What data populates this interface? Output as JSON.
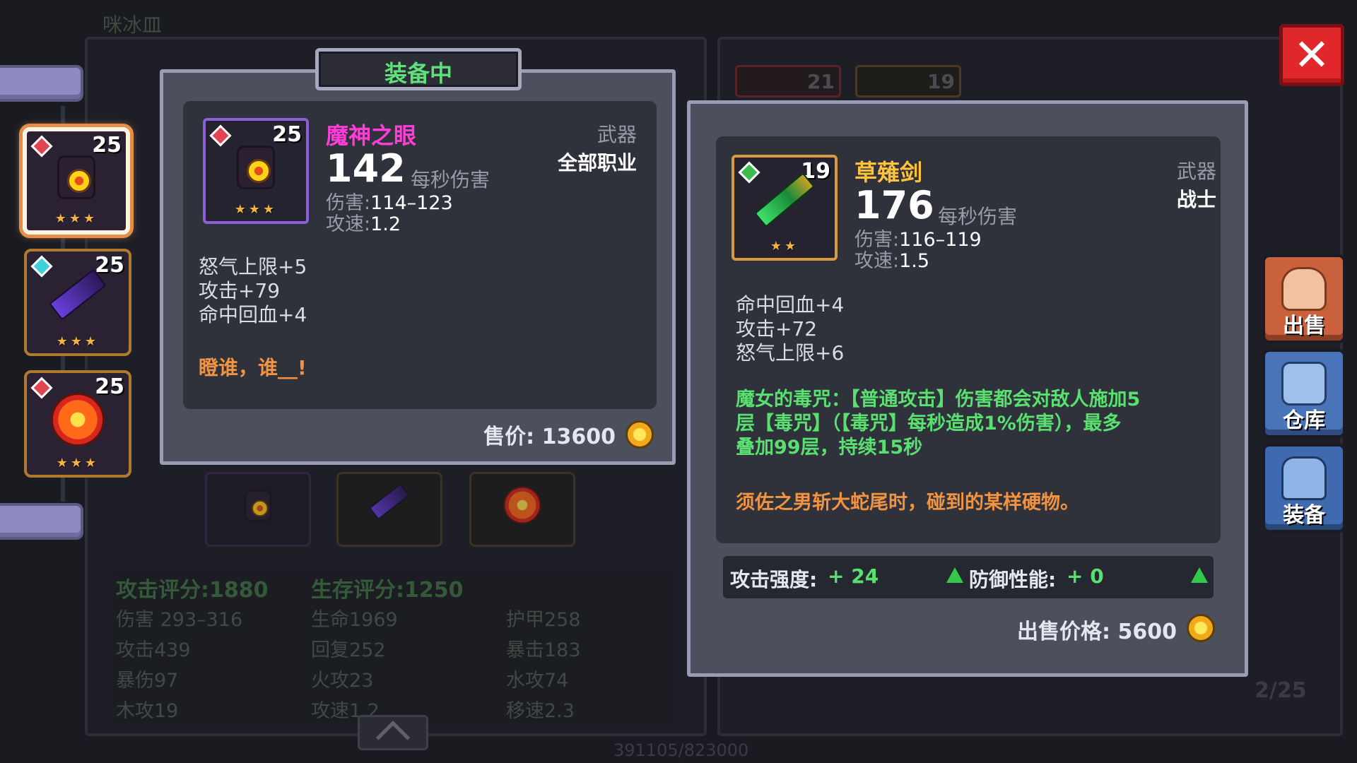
{
  "background": {
    "top_title": "咪冰皿",
    "page_indicator": "2/25",
    "exp_text": "391105/823000",
    "mini_counts": [
      "21",
      "19"
    ]
  },
  "left_slots": [
    {
      "level": "25",
      "gem": "red",
      "stars": "★★★",
      "item": "eye",
      "selected": true
    },
    {
      "level": "25",
      "gem": "cyan",
      "stars": "★★★",
      "item": "sword",
      "selected": false
    },
    {
      "level": "25",
      "gem": "red",
      "stars": "★★★",
      "item": "sun",
      "selected": false
    }
  ],
  "equipped_panel": {
    "tab_label": "装备中",
    "name": "魔神之眼",
    "level": "25",
    "type": "武器",
    "class": "全部职业",
    "dps": "142",
    "dps_label": "每秒伤害",
    "damage_label": "伤害:",
    "damage": "114–123",
    "speed_label": "攻速:",
    "speed": "1.2",
    "stars": "★★★",
    "attributes": [
      "怒气上限+5",
      "攻击+79",
      "命中回血+4"
    ],
    "flavor": "瞪谁，谁__!",
    "price_label": "售价:",
    "price": "13600",
    "name_color": "#ff3ed8"
  },
  "compare_panel": {
    "name": "草薙剑",
    "level": "19",
    "type": "武器",
    "class": "战士",
    "dps": "176",
    "dps_label": "每秒伤害",
    "damage_label": "伤害:",
    "damage": "116–119",
    "speed_label": "攻速:",
    "speed": "1.5",
    "stars": "★★",
    "attributes": [
      "命中回血+4",
      "攻击+72",
      "怒气上限+6"
    ],
    "skill_lines": [
      "魔女的毒咒：【普通攻击】伤害都会对敌人施加5",
      "层【毒咒】（【毒咒】每秒造成1%伤害），最多",
      "叠加99层，持续15秒"
    ],
    "flavor": "须佐之男斩大蛇尾时，碰到的某样硬物。",
    "atk_label": "攻击强度:",
    "atk_value": "+ 24",
    "def_label": "防御性能:",
    "def_value": "+ 0",
    "price_label": "出售价格:",
    "price": "5600",
    "name_color": "#ffc23a"
  },
  "side_buttons": [
    {
      "label": "出售",
      "color": "#c9623c",
      "icon": "money-bag-icon"
    },
    {
      "label": "仓库",
      "color": "#4a74b8",
      "icon": "warehouse-icon"
    },
    {
      "label": "装备",
      "color": "#3f6ab0",
      "icon": "armor-icon"
    }
  ],
  "summary": {
    "attack_score_label": "攻击评分:",
    "attack_score": "1880",
    "survival_score_label": "生存评分:",
    "survival_score": "1250",
    "stats": [
      [
        "伤害 293–316",
        "生命1969",
        "护甲258"
      ],
      [
        "攻击439",
        "回复252",
        "暴击183"
      ],
      [
        "暴伤97",
        "火攻23",
        "水攻74"
      ],
      [
        "木攻19",
        "攻速1.2",
        "移速2.3"
      ]
    ]
  },
  "close_label": "✕"
}
